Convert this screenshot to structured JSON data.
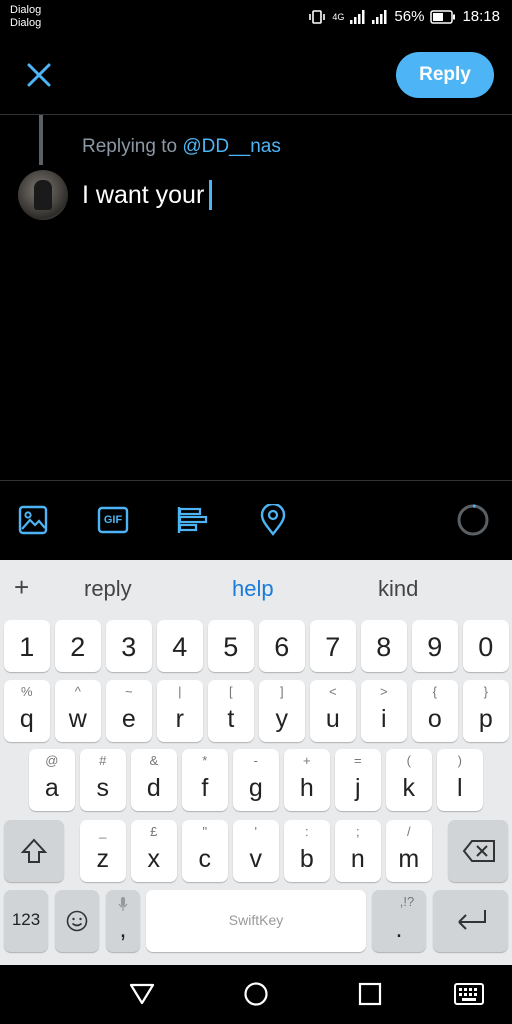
{
  "status_bar": {
    "carrier_line1": "Dialog",
    "carrier_line2": "Dialog",
    "network": "4G",
    "battery": "56%",
    "time": "18:18"
  },
  "header": {
    "close_icon": "close-icon",
    "reply_label": "Reply"
  },
  "compose": {
    "replying_prefix": "Replying to ",
    "replying_handle": "@DD__nas",
    "text": "I want your"
  },
  "toolbar": {
    "icons": [
      "image-icon",
      "gif-icon",
      "poll-icon",
      "location-icon"
    ],
    "gif_label": "GIF"
  },
  "keyboard": {
    "suggestions": [
      "reply",
      "help",
      "kind"
    ],
    "number_row": [
      "1",
      "2",
      "3",
      "4",
      "5",
      "6",
      "7",
      "8",
      "9",
      "0"
    ],
    "row1": [
      {
        "main": "q",
        "sub": "%"
      },
      {
        "main": "w",
        "sub": "^"
      },
      {
        "main": "e",
        "sub": "~"
      },
      {
        "main": "r",
        "sub": "|"
      },
      {
        "main": "t",
        "sub": "["
      },
      {
        "main": "y",
        "sub": "]"
      },
      {
        "main": "u",
        "sub": "<"
      },
      {
        "main": "i",
        "sub": ">"
      },
      {
        "main": "o",
        "sub": "{"
      },
      {
        "main": "p",
        "sub": "}"
      }
    ],
    "row2": [
      {
        "main": "a",
        "sub": "@"
      },
      {
        "main": "s",
        "sub": "#"
      },
      {
        "main": "d",
        "sub": "&"
      },
      {
        "main": "f",
        "sub": "*"
      },
      {
        "main": "g",
        "sub": "-"
      },
      {
        "main": "h",
        "sub": "+"
      },
      {
        "main": "j",
        "sub": "="
      },
      {
        "main": "k",
        "sub": "("
      },
      {
        "main": "l",
        "sub": ")"
      }
    ],
    "row3": [
      {
        "main": "z",
        "sub": "_"
      },
      {
        "main": "x",
        "sub": "£"
      },
      {
        "main": "c",
        "sub": "\""
      },
      {
        "main": "v",
        "sub": "'"
      },
      {
        "main": "b",
        "sub": ":"
      },
      {
        "main": "n",
        "sub": ";"
      },
      {
        "main": "m",
        "sub": "/"
      }
    ],
    "numbers_key": "123",
    "comma_key": ",",
    "space_label": "SwiftKey",
    "period_key": ".",
    "period_sub": ",!?"
  },
  "colors": {
    "accent": "#4db5f5",
    "suggestion_highlight": "#1a7bd8",
    "background": "#000000",
    "keyboard_bg": "#e8eaec"
  }
}
